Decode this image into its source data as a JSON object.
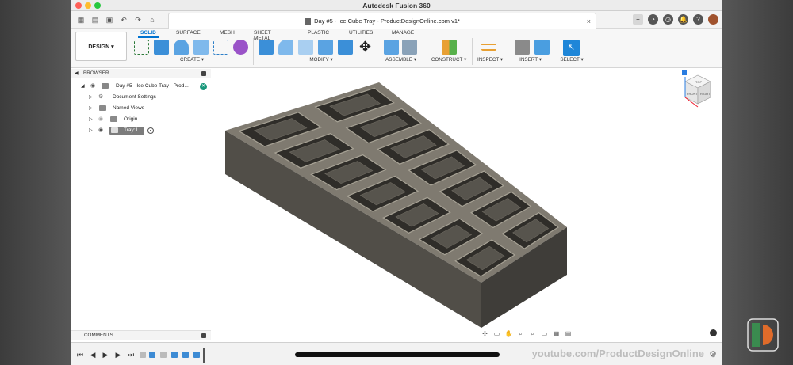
{
  "window": {
    "title": "Autodesk Fusion 360"
  },
  "document": {
    "tab_title": "Day #5 - Ice Cube Tray - ProductDesignOnline.com v1*"
  },
  "workspace": {
    "design_label": "DESIGN ▾"
  },
  "tabs": [
    {
      "label": "SOLID",
      "active": true
    },
    {
      "label": "SURFACE"
    },
    {
      "label": "MESH"
    },
    {
      "label": "SHEET METAL"
    },
    {
      "label": "PLASTIC"
    },
    {
      "label": "UTILITIES"
    },
    {
      "label": "MANAGE"
    }
  ],
  "groups": {
    "create": "CREATE ▾",
    "modify": "MODIFY ▾",
    "assemble": "ASSEMBLE ▾",
    "construct": "CONSTRUCT ▾",
    "inspect": "INSPECT ▾",
    "insert": "INSERT ▾",
    "select": "SELECT ▾"
  },
  "browser": {
    "header": "BROWSER",
    "root": "Day #5 - Ice Cube Tray - Prod...",
    "items": [
      "Document Settings",
      "Named Views",
      "Origin",
      "Tray:1"
    ]
  },
  "comments": {
    "header": "COMMENTS"
  },
  "viewcube": {
    "front": "FRONT",
    "right": "RIGHT",
    "top": "TOP"
  },
  "watermark": "youtube.com/ProductDesignOnline",
  "colors": {
    "accent": "#0073d1",
    "model": "#5a5750",
    "select_icon": "#1e86d8"
  }
}
